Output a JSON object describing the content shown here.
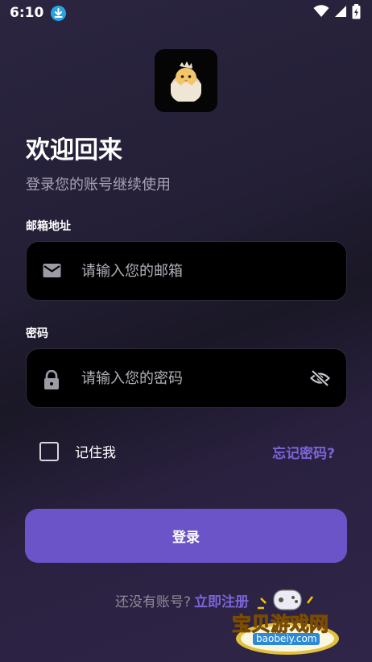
{
  "status_bar": {
    "time": "6:10"
  },
  "app_logo": {
    "icon": "chick-in-egg-logo"
  },
  "header": {
    "title": "欢迎回来",
    "subtitle": "登录您的账号继续使用"
  },
  "email": {
    "label": "邮箱地址",
    "placeholder": "请输入您的邮箱",
    "value": ""
  },
  "password": {
    "label": "密码",
    "placeholder": "请输入您的密码",
    "value": ""
  },
  "remember_me": {
    "label": "记住我",
    "checked": false
  },
  "forgot_password": "忘记密码?",
  "login_button": "登录",
  "signup": {
    "prompt": "还没有账号?",
    "link": "立即注册"
  },
  "watermark": {
    "text": "宝贝游戏网",
    "url": "baobeiy.com"
  },
  "colors": {
    "accent": "#6b53c8",
    "link": "#7a65d8",
    "field_bg": "#000000",
    "background": "#251f36"
  }
}
